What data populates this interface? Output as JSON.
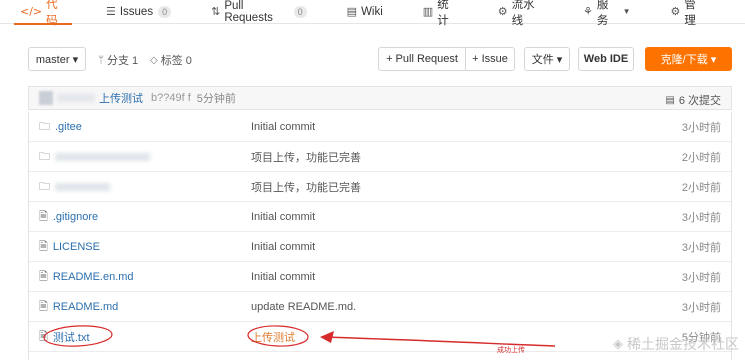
{
  "tabs": [
    {
      "icon": "code-icon",
      "glyph": "</>",
      "label": "代码",
      "active": true
    },
    {
      "icon": "issues-icon",
      "glyph": "☰",
      "label": "Issues",
      "badge": "0"
    },
    {
      "icon": "pull-request-icon",
      "glyph": "⇅",
      "label": "Pull Requests",
      "badge": "0"
    },
    {
      "icon": "wiki-icon",
      "glyph": "▤",
      "label": "Wiki"
    },
    {
      "icon": "stats-icon",
      "glyph": "▥",
      "label": "统计"
    },
    {
      "icon": "pipeline-icon",
      "glyph": "⚙",
      "label": "流水线"
    },
    {
      "icon": "service-icon",
      "glyph": "⚘",
      "label": "服务",
      "caret": "▼"
    },
    {
      "icon": "manage-icon",
      "glyph": "⚙",
      "label": "管理"
    }
  ],
  "toolbar": {
    "branch": "master ▾",
    "branches_label": "分支 1",
    "tags_label": "标签 0",
    "pull_request": "+ Pull Request",
    "issue": "+ Issue",
    "file": "文件 ▾",
    "web_ide": "Web IDE",
    "download": "克隆/下载 ▾"
  },
  "commit": {
    "message": "上传测试",
    "hash": "b??49f f",
    "time": "5分钟前",
    "count": "6 次提交"
  },
  "files": [
    {
      "type": "folder",
      "name": ".gitee",
      "message": "Initial commit",
      "time": "3小时前"
    },
    {
      "type": "folder",
      "name": "",
      "blur_w": 95,
      "message": "项目上传，功能已完善",
      "time": "2小时前"
    },
    {
      "type": "folder",
      "name": "",
      "blur_w": 55,
      "message": "项目上传，功能已完善",
      "time": "2小时前"
    },
    {
      "type": "file",
      "name": ".gitignore",
      "message": "Initial commit",
      "time": "3小时前"
    },
    {
      "type": "file",
      "name": "LICENSE",
      "message": "Initial commit",
      "time": "3小时前"
    },
    {
      "type": "file",
      "name": "README.en.md",
      "message": "Initial commit",
      "time": "3小时前"
    },
    {
      "type": "file",
      "name": "README.md",
      "message": "update README.md.",
      "time": "3小时前"
    },
    {
      "type": "file",
      "name": "测试.txt",
      "message": "上传测试",
      "time": "5分钟前",
      "circled": true
    }
  ],
  "annotation": {
    "label": "成功上传",
    "color": "#d72a2a"
  },
  "watermark": "稀土掘金技术社区",
  "colors": {
    "accent": "#e86a1f",
    "download": "#fe7300",
    "link": "#2c6fae"
  }
}
